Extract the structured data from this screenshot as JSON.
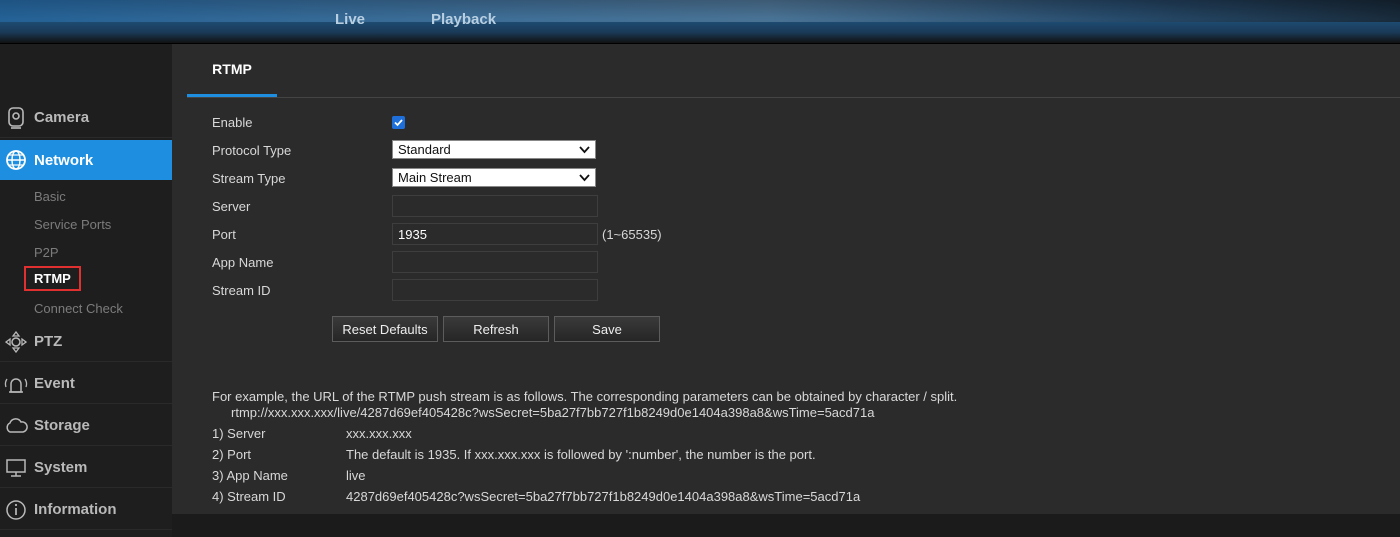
{
  "topnav": {
    "live": "Live",
    "playback": "Playback"
  },
  "sidebar": {
    "camera": {
      "label": "Camera",
      "icon": "camera-icon"
    },
    "network": {
      "label": "Network",
      "icon": "network-globe-icon"
    },
    "subitems": [
      "Basic",
      "Service Ports",
      "P2P",
      "RTMP",
      "Connect Check"
    ],
    "ptz": {
      "label": "PTZ",
      "icon": "ptz-icon"
    },
    "event": {
      "label": "Event",
      "icon": "alarm-icon"
    },
    "storage": {
      "label": "Storage",
      "icon": "cloud-icon"
    },
    "system": {
      "label": "System",
      "icon": "monitor-icon"
    },
    "information": {
      "label": "Information",
      "icon": "info-icon"
    }
  },
  "tab": {
    "label": "RTMP"
  },
  "form": {
    "enable_label": "Enable",
    "enable_checked": true,
    "protocol_label": "Protocol Type",
    "protocol_value": "Standard",
    "stream_label": "Stream Type",
    "stream_value": "Main Stream",
    "server_label": "Server",
    "server_value": "",
    "port_label": "Port",
    "port_value": "1935",
    "port_hint": "(1~65535)",
    "appname_label": "App Name",
    "appname_value": "",
    "streamid_label": "Stream ID",
    "streamid_value": ""
  },
  "buttons": {
    "reset": "Reset Defaults",
    "refresh": "Refresh",
    "save": "Save"
  },
  "notes": {
    "intro": "For example, the URL of the RTMP push stream is as follows. The corresponding parameters can be obtained by character / split.",
    "url": "rtmp://xxx.xxx.xxx/live/4287d69ef405428c?wsSecret=5ba27f7bb727f1b8249d0e1404a398a8&wsTime=5acd71a",
    "rows": [
      {
        "k": "1) Server",
        "v": "xxx.xxx.xxx"
      },
      {
        "k": "2) Port",
        "v": "The default is 1935. If xxx.xxx.xxx is followed by ':number', the number is the port."
      },
      {
        "k": "3) App Name",
        "v": "live"
      },
      {
        "k": "4) Stream ID",
        "v": "4287d69ef405428c?wsSecret=5ba27f7bb727f1b8249d0e1404a398a8&wsTime=5acd71a"
      }
    ]
  },
  "colors": {
    "accent": "#1e8fe0",
    "highlight_border": "#e0302f"
  }
}
